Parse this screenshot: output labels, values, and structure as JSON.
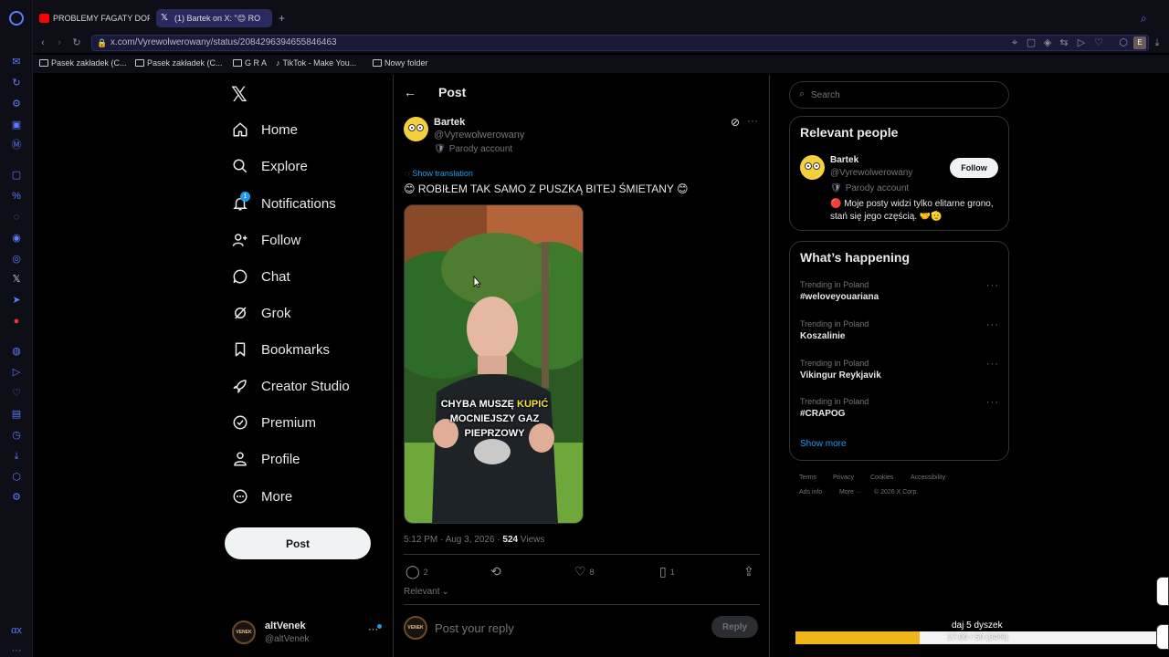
{
  "browser": {
    "tabs": [
      {
        "label": "PROBLEMY FAGATY DOPIE",
        "favicon": "youtube-icon",
        "active": false
      },
      {
        "label": "(1) Bartek on X: \"😊 RO",
        "favicon": "x-icon",
        "active": true
      }
    ],
    "url": "x.com/Vyrewolwerowany/status/2084296394655846463",
    "bookmarks": [
      "Pasek zakładek (C...",
      "Pasek zakładek (C...",
      "G R A",
      "TikTok - Make You...",
      "Nowy folder"
    ]
  },
  "nav": {
    "items": [
      {
        "label": "Home",
        "icon": "home-icon"
      },
      {
        "label": "Explore",
        "icon": "search-icon"
      },
      {
        "label": "Notifications",
        "icon": "bell-icon",
        "badge": "1"
      },
      {
        "label": "Follow",
        "icon": "person-plus-icon"
      },
      {
        "label": "Chat",
        "icon": "chat-icon"
      },
      {
        "label": "Grok",
        "icon": "grok-icon"
      },
      {
        "label": "Bookmarks",
        "icon": "bookmark-icon"
      },
      {
        "label": "Creator Studio",
        "icon": "rocket-icon"
      },
      {
        "label": "Premium",
        "icon": "premium-icon"
      },
      {
        "label": "Profile",
        "icon": "profile-icon"
      },
      {
        "label": "More",
        "icon": "more-icon"
      }
    ],
    "post_button": "Post",
    "account": {
      "name": "altVenek",
      "handle": "@altVenek",
      "avatar_text": "VENEK"
    }
  },
  "post": {
    "header": "Post",
    "author_name": "Bartek",
    "author_handle": "@Vyrewolwerowany",
    "parody_label": "Parody account",
    "show_translation": "Show translation",
    "text": "😊 ROBIŁEM TAK SAMO Z PUSZKĄ BITEJ ŚMIETANY 😊",
    "video_caption": [
      "CHYBA MUSZĘ ",
      "KUPIĆ",
      "MOCNIEJSZY GAZ",
      "PIEPRZOWY"
    ],
    "timestamp": "5:12 PM · Aug 3, 2026 · ",
    "views_count": "524",
    "views_label": " Views",
    "replies": "2",
    "likes": "8",
    "bookmarks": "1",
    "sort_label": "Relevant",
    "reply_placeholder": "Post your reply",
    "reply_button": "Reply"
  },
  "sidebar": {
    "search_placeholder": "Search",
    "relevant_title": "Relevant people",
    "person": {
      "name": "Bartek",
      "handle": "@Vyrewolwerowany",
      "parody": "Parody account",
      "bio": "🔴 Moje posty widzi tylko elitarne grono, stań się jego częścią. 🤝🫡",
      "follow_label": "Follow"
    },
    "happening_title": "What’s happening",
    "trends": [
      {
        "category": "Trending in Poland",
        "name": "#weloveyouariana"
      },
      {
        "category": "Trending in Poland",
        "name": "Koszalinie"
      },
      {
        "category": "Trending in Poland",
        "name": "Vikingur Reykjavik"
      },
      {
        "category": "Trending in Poland",
        "name": "#CRAPOG"
      }
    ],
    "show_more": "Show more",
    "footer": [
      "Terms",
      "Privacy",
      "Cookies",
      "Accessibility",
      "Ads info",
      "More ···",
      "© 2026 X Corp."
    ]
  },
  "overlay": {
    "goal_label": "daj 5 dyszek",
    "progress_text": "17.00 / 50 (34%)",
    "progress_fraction": 0.34,
    "progress_color": "#f1b51c"
  },
  "colors": {
    "accent": "#1d9bf0",
    "browser_accent": "#5b7cff"
  }
}
